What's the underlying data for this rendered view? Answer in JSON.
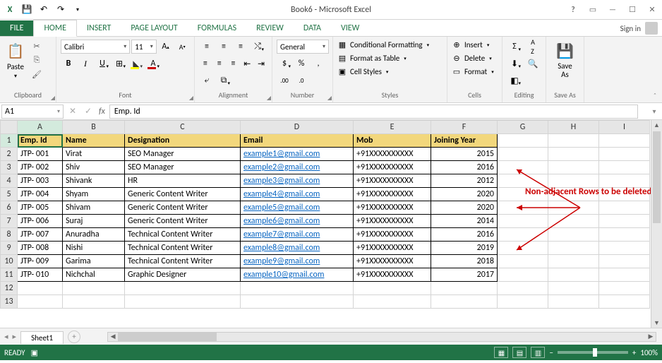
{
  "title": "Book6 - Microsoft Excel",
  "signin": "Sign in",
  "tabs": [
    "FILE",
    "HOME",
    "INSERT",
    "PAGE LAYOUT",
    "FORMULAS",
    "REVIEW",
    "DATA",
    "VIEW"
  ],
  "active_tab": "HOME",
  "ribbon": {
    "clipboard": {
      "label": "Clipboard",
      "paste": "Paste"
    },
    "font": {
      "label": "Font",
      "name": "Calibri",
      "size": "11"
    },
    "alignment": {
      "label": "Alignment"
    },
    "number": {
      "label": "Number",
      "format": "General"
    },
    "styles": {
      "label": "Styles",
      "cf": "Conditional Formatting",
      "fat": "Format as Table",
      "cs": "Cell Styles"
    },
    "cells": {
      "label": "Cells",
      "insert": "Insert",
      "delete": "Delete",
      "format": "Format"
    },
    "editing": {
      "label": "Editing"
    },
    "saveas": {
      "label": "Save As",
      "btn": "Save\nAs"
    }
  },
  "namebox": "A1",
  "formula": "Emp. Id",
  "columns": [
    "A",
    "B",
    "C",
    "D",
    "E",
    "F",
    "G",
    "H",
    "I"
  ],
  "headers_row": [
    "Emp. Id",
    "Name",
    "Designation",
    "Email",
    "Mob",
    "Joining Year"
  ],
  "rows": [
    {
      "n": 1,
      "cells": [
        "Emp. Id",
        "Name",
        "Designation",
        "Email",
        "Mob",
        "Joining Year"
      ],
      "header": true
    },
    {
      "n": 2,
      "cells": [
        "JTP- 001",
        "Virat",
        "SEO Manager",
        "example1@gmail.com",
        "+91XXXXXXXXXX",
        "2015"
      ]
    },
    {
      "n": 3,
      "cells": [
        "JTP- 002",
        "Shiv",
        "SEO Manager",
        "example2@gmail.com",
        "+91XXXXXXXXXX",
        "2016"
      ]
    },
    {
      "n": 4,
      "cells": [
        "JTP- 003",
        "Shivank",
        "HR",
        "example3@gmail.com",
        "+91XXXXXXXXXX",
        "2012"
      ]
    },
    {
      "n": 5,
      "cells": [
        "JTP- 004",
        "Shyam",
        "Generic Content Writer",
        "example4@gmail.com",
        "+91XXXXXXXXXX",
        "2020"
      ]
    },
    {
      "n": 6,
      "cells": [
        "JTP- 005",
        "Shivam",
        "Generic Content Writer",
        "example5@gmail.com",
        "+91XXXXXXXXXX",
        "2020"
      ]
    },
    {
      "n": 7,
      "cells": [
        "JTP- 006",
        "Suraj",
        "Generic Content Writer",
        "example6@gmail.com",
        "+91XXXXXXXXXX",
        "2014"
      ]
    },
    {
      "n": 8,
      "cells": [
        "JTP- 007",
        "Anuradha",
        "Technical Content Writer",
        "example7@gmail.com",
        "+91XXXXXXXXXX",
        "2016"
      ]
    },
    {
      "n": 9,
      "cells": [
        "JTP- 008",
        "Nishi",
        "Technical Content Writer",
        "example8@gmail.com",
        "+91XXXXXXXXXX",
        "2019"
      ]
    },
    {
      "n": 10,
      "cells": [
        "JTP- 009",
        "Garima",
        "Technical Content Writer",
        "example9@gmail.com",
        "+91XXXXXXXXXX",
        "2018"
      ]
    },
    {
      "n": 11,
      "cells": [
        "JTP- 010",
        "Nichchal",
        "Graphic Designer",
        "example10@gmail.com",
        "+91XXXXXXXXXX",
        "2017"
      ]
    },
    {
      "n": 12,
      "cells": [
        "",
        "",
        "",
        "",
        "",
        ""
      ],
      "empty": true
    },
    {
      "n": 13,
      "cells": [
        "",
        "",
        "",
        "",
        "",
        ""
      ],
      "empty": true
    }
  ],
  "annotation": "Non-adjacent Rows to be deleted",
  "sheet": "Sheet1",
  "status": "READY",
  "zoom": "100%"
}
